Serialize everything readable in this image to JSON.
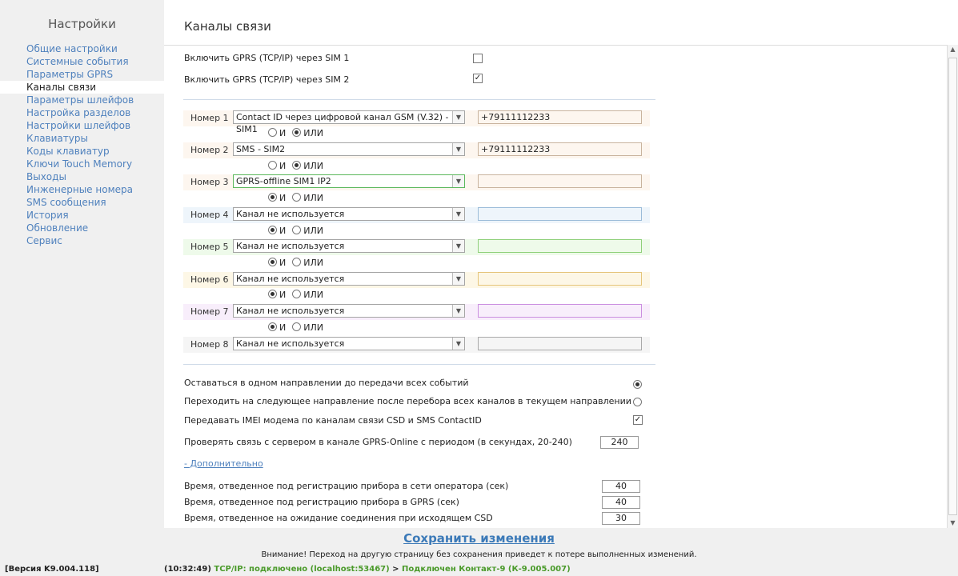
{
  "sidebar": {
    "title": "Настройки",
    "items": [
      {
        "label": "Общие настройки"
      },
      {
        "label": "Системные события"
      },
      {
        "label": "Параметры GPRS"
      },
      {
        "label": "Каналы связи",
        "active": true
      },
      {
        "label": "Параметры шлейфов"
      },
      {
        "label": "Настройка разделов"
      },
      {
        "label": "Настройки шлейфов"
      },
      {
        "label": "Клавиатуры"
      },
      {
        "label": "Коды клавиатур"
      },
      {
        "label": "Ключи Touch Memory"
      },
      {
        "label": "Выходы"
      },
      {
        "label": "Инженерные номера"
      },
      {
        "label": "SMS сообщения"
      },
      {
        "label": "История"
      },
      {
        "label": "Обновление"
      },
      {
        "label": "Сервис"
      }
    ]
  },
  "page": {
    "title": "Каналы связи"
  },
  "gprs": {
    "sim1": {
      "label": "Включить GPRS (TCP/IP) через SIM 1",
      "checked": false,
      "mark": ""
    },
    "sim2": {
      "label": "Включить GPRS (TCP/IP) через SIM 2",
      "checked": true,
      "mark": "✓"
    }
  },
  "channels": [
    {
      "label": "Номер 1",
      "select": "Contact ID через цифровой канал GSM (V.32) - SIM1",
      "phone": "+79111112233",
      "bg": "#fdf6ef",
      "phone_border": "#c9b49e"
    },
    {
      "label": "Номер 2",
      "select": "SMS - SIM2",
      "phone": "+79111112233",
      "bg": "#fdf6ef",
      "phone_border": "#c9b49e"
    },
    {
      "label": "Номер 3",
      "select": "GPRS-offline SIM1 IP2",
      "phone": "",
      "bg": "#fdf6ef",
      "phone_border": "#c9b49e",
      "select_border": "#5cb85c"
    },
    {
      "label": "Номер 4",
      "select": "Канал не используется",
      "phone": "",
      "bg": "#eef5fb",
      "phone_border": "#9cbcd9"
    },
    {
      "label": "Номер 5",
      "select": "Канал не используется",
      "phone": "",
      "bg": "#eefaea",
      "phone_border": "#8fd07a"
    },
    {
      "label": "Номер 6",
      "select": "Канал не используется",
      "phone": "",
      "bg": "#fdf7e6",
      "phone_border": "#e5c57a"
    },
    {
      "label": "Номер 7",
      "select": "Канал не используется",
      "phone": "",
      "bg": "#f8eefb",
      "phone_border": "#cb8fe0"
    },
    {
      "label": "Номер 8",
      "select": "Канал не используется",
      "phone": "",
      "bg": "#f5f5f5",
      "phone_border": "#aaaaaa"
    }
  ],
  "logic": {
    "and_label": "И",
    "or_label": "ИЛИ",
    "rows": [
      {
        "and": false,
        "or": true
      },
      {
        "and": false,
        "or": true
      },
      {
        "and": true,
        "or": false
      },
      {
        "and": true,
        "or": false
      },
      {
        "and": true,
        "or": false
      },
      {
        "and": true,
        "or": false
      },
      {
        "and": true,
        "or": false
      }
    ]
  },
  "options": {
    "stay_direction": {
      "label": "Оставаться в одном направлении до передачи всех событий",
      "selected": true
    },
    "next_direction": {
      "label": "Переходить на следующее направление после перебора всех каналов в текущем направлении",
      "selected": false
    },
    "imei": {
      "label": "Передавать IMEI модема по каналам связи CSD и SMS ContactID",
      "checked": true,
      "mark": "✓"
    },
    "server_check": {
      "label": "Проверять связь с сервером в канале GPRS-Online с периодом (в секундах, 20-240)",
      "value": "240"
    },
    "more_link": "- Дополнительно"
  },
  "timeouts": [
    {
      "label": "Время, отведенное под регистрацию прибора в сети оператора (сек)",
      "value": "40"
    },
    {
      "label": "Время, отведенное под регистрацию прибора в GPRS (сек)",
      "value": "40"
    },
    {
      "label": "Время, отведенное на ожидание соединения при исходящем CSD",
      "value": "30"
    }
  ],
  "footer": {
    "save_label": "Сохранить изменения",
    "warning": "Внимание! Переход на другую страницу без сохранения приведет к потере выполненных изменений."
  },
  "status": {
    "version": "[Версия K9.004.118]",
    "time": "(10:32:49)",
    "tcp": "TCP/IP: подключено (localhost:53467)",
    "arrow": " > ",
    "device": "Подключен Контакт-9 (К-9.005.007)"
  },
  "icons": {
    "dropdown": "triangle-down",
    "scroll_up": "triangle-up",
    "scroll_down": "triangle-down"
  }
}
